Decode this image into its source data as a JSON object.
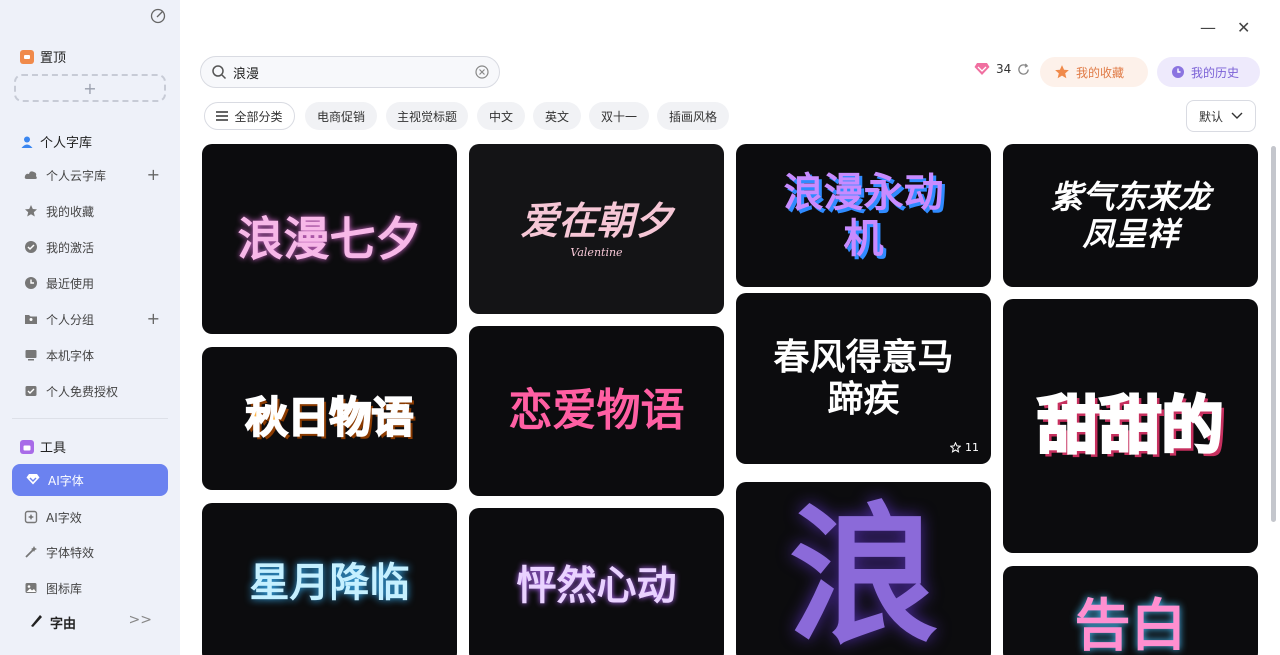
{
  "sidebar": {
    "pinned_label": "置顶",
    "add_symbol": "+",
    "library_label": "个人字库",
    "items": [
      {
        "label": "个人云字库",
        "plus": "+"
      },
      {
        "label": "我的收藏"
      },
      {
        "label": "我的激活"
      },
      {
        "label": "最近使用"
      },
      {
        "label": "个人分组",
        "plus": "+"
      },
      {
        "label": "本机字体"
      },
      {
        "label": "个人免费授权"
      }
    ],
    "tools_label": "工具",
    "tools": [
      {
        "label": "AI字体"
      },
      {
        "label": "AI字效"
      },
      {
        "label": "字体特效"
      },
      {
        "label": "图标库"
      }
    ],
    "brand": "字由",
    "expand": ">>"
  },
  "window": {
    "minimize": "—",
    "close": "✕"
  },
  "search": {
    "value": "浪漫"
  },
  "credits": {
    "count": "34"
  },
  "header": {
    "favorites_label": "我的收藏",
    "history_label": "我的历史"
  },
  "filters": {
    "all": "全部分类",
    "chips": [
      "电商促销",
      "主视觉标题",
      "中文",
      "英文",
      "双十一",
      "插画风格"
    ],
    "sort": "默认"
  },
  "cards": [
    {
      "text": "浪漫七夕",
      "sub": ""
    },
    {
      "text": "秋日物语",
      "sub": ""
    },
    {
      "text": "星月降临",
      "sub": ""
    },
    {
      "text": "爱在朝夕",
      "sub": "Valentine"
    },
    {
      "text": "恋爱物语",
      "sub": ""
    },
    {
      "text": "怦然心动",
      "sub": ""
    },
    {
      "text": "浪漫永动机",
      "sub": ""
    },
    {
      "text": "春风得意马蹄疾",
      "sub": "",
      "fav": "11"
    },
    {
      "text": "浪",
      "sub": ""
    },
    {
      "text": "紫气东来龙凤呈祥",
      "sub": ""
    },
    {
      "text": "甜甜的",
      "sub": ""
    },
    {
      "text": "告白",
      "sub": ""
    }
  ],
  "colors": {
    "accent": "#6b82f0",
    "card_bg": "#0c0c0e"
  }
}
